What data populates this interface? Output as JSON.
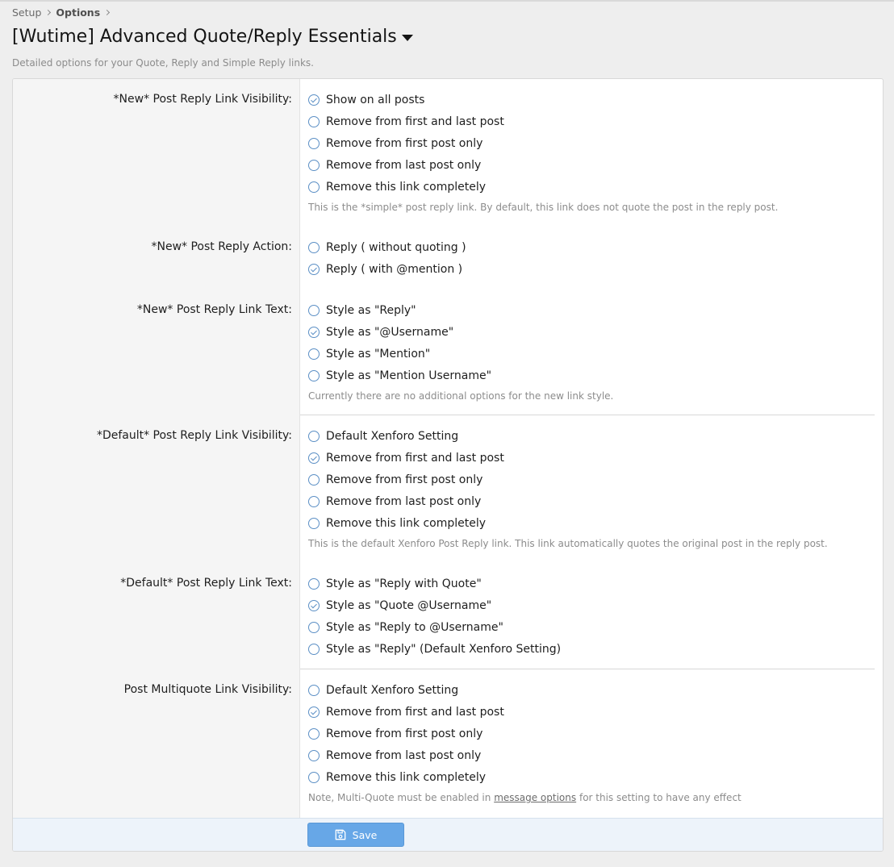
{
  "breadcrumb": {
    "items": [
      "Setup",
      "Options"
    ]
  },
  "page": {
    "title": "[Wutime] Advanced Quote/Reply Essentials",
    "description": "Detailed options for your Quote, Reply and Simple Reply links."
  },
  "options": [
    {
      "label": "*New* Post Reply Link Visibility:",
      "choices": [
        "Show on all posts",
        "Remove from first and last post",
        "Remove from first post only",
        "Remove from last post only",
        "Remove this link completely"
      ],
      "selected": 0,
      "hint": "This is the *simple* post reply link. By default, this link does not quote the post in the reply post."
    },
    {
      "label": "*New* Post Reply Action:",
      "choices": [
        "Reply ( without quoting )",
        "Reply ( with @mention )"
      ],
      "selected": 1,
      "hint": ""
    },
    {
      "label": "*New* Post Reply Link Text:",
      "choices": [
        "Style as \"Reply\"",
        "Style as \"@Username\"",
        "Style as \"Mention\"",
        "Style as \"Mention Username\""
      ],
      "selected": 1,
      "hint": "Currently there are no additional options for the new link style."
    },
    {
      "label": "*Default* Post Reply Link Visibility:",
      "choices": [
        "Default Xenforo Setting",
        "Remove from first and last post",
        "Remove from first post only",
        "Remove from last post only",
        "Remove this link completely"
      ],
      "selected": 1,
      "hint": "This is the default Xenforo Post Reply link. This link automatically quotes the original post in the reply post."
    },
    {
      "label": "*Default* Post Reply Link Text:",
      "choices": [
        "Style as \"Reply with Quote\"",
        "Style as \"Quote @Username\"",
        "Style as \"Reply to @Username\"",
        "Style as \"Reply\" (Default Xenforo Setting)"
      ],
      "selected": 1,
      "hint": ""
    },
    {
      "label": "Post Multiquote Link Visibility:",
      "choices": [
        "Default Xenforo Setting",
        "Remove from first and last post",
        "Remove from first post only",
        "Remove from last post only",
        "Remove this link completely"
      ],
      "selected": 1,
      "hint_before": "Note, Multi-Quote must be enabled in",
      "hint_link": "message options",
      "hint_after": "for this setting to have any effect"
    }
  ],
  "footer": {
    "save_label": "Save"
  },
  "colors": {
    "accent": "#5b8fc5",
    "button": "#67a7e7"
  }
}
